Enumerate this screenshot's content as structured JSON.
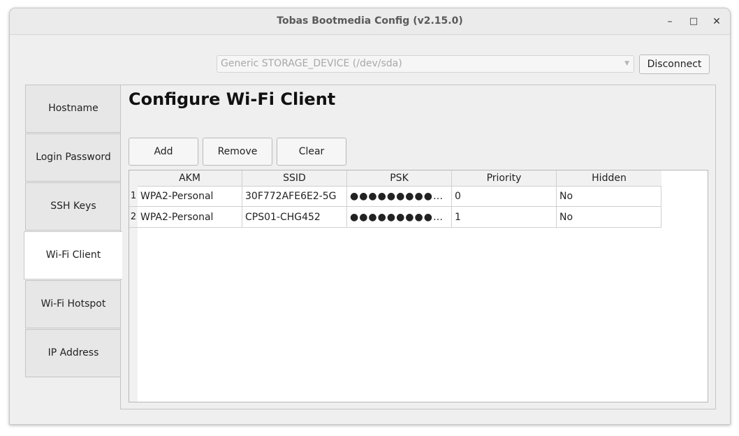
{
  "window": {
    "title": "Tobas Bootmedia Config (v2.15.0)",
    "minimize_glyph": "–",
    "maximize_glyph": "□",
    "close_glyph": "✕"
  },
  "device": {
    "selected": "Generic STORAGE_DEVICE (/dev/sda)",
    "disconnect_label": "Disconnect",
    "arrow_icon": "chevron-down-icon"
  },
  "tabs": [
    {
      "label": "Hostname"
    },
    {
      "label": "Login Password"
    },
    {
      "label": "SSH Keys"
    },
    {
      "label": "Wi-Fi Client"
    },
    {
      "label": "Wi-Fi Hotspot"
    },
    {
      "label": "IP Address"
    }
  ],
  "active_tab": "Wi-Fi Client",
  "main": {
    "heading": "Configure Wi-Fi Client",
    "buttons": {
      "add": "Add",
      "remove": "Remove",
      "clear": "Clear"
    }
  },
  "table": {
    "columns": [
      "AKM",
      "SSID",
      "PSK",
      "Priority",
      "Hidden"
    ],
    "rows": [
      {
        "num": "1",
        "akm": "WPA2-Personal",
        "ssid": "30F772AFE6E2-5G",
        "psk": "●●●●●●●●●…",
        "priority": "0",
        "hidden": "No"
      },
      {
        "num": "2",
        "akm": "WPA2-Personal",
        "ssid": "CPS01-CHG452",
        "psk": "●●●●●●●●●…",
        "priority": "1",
        "hidden": "No"
      }
    ]
  }
}
